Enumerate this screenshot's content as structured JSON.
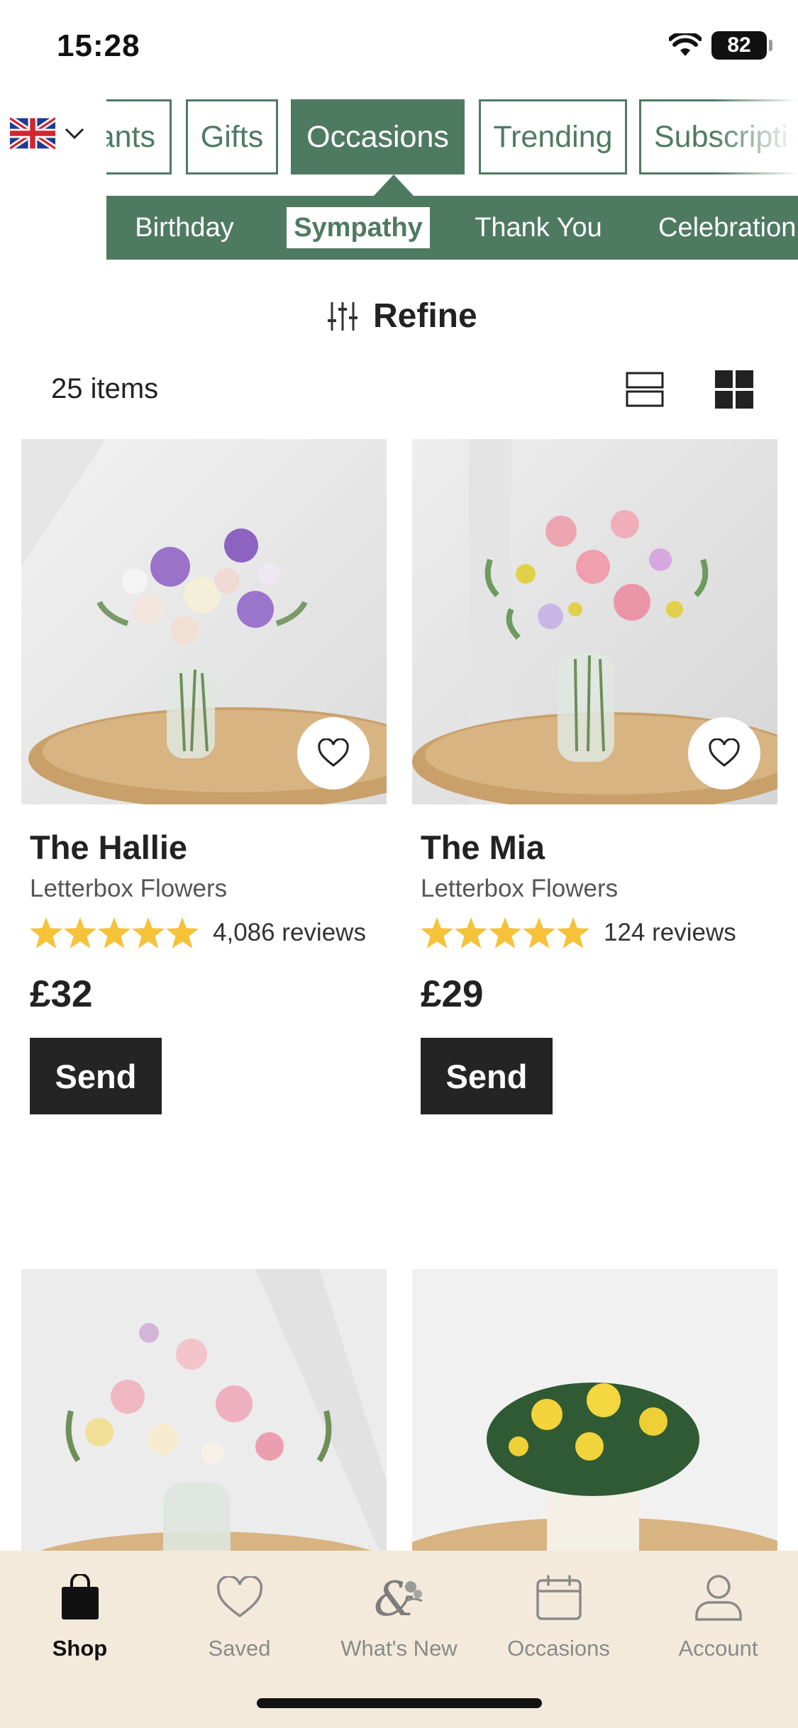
{
  "status_bar": {
    "time": "15:28",
    "battery": "82"
  },
  "colors": {
    "brand_green": "#4f7a62",
    "star_yellow": "#f5c23a",
    "tab_bar_bg": "#f4eadb",
    "button_dark": "#242424"
  },
  "nav": {
    "categories": [
      {
        "label": "ants",
        "active": false
      },
      {
        "label": "Gifts",
        "active": false
      },
      {
        "label": "Occasions",
        "active": true
      },
      {
        "label": "Trending",
        "active": false
      },
      {
        "label": "Subscripti",
        "active": false
      }
    ],
    "subcategories": [
      {
        "label": "Birthday",
        "active": false
      },
      {
        "label": "Sympathy",
        "active": true
      },
      {
        "label": "Thank You",
        "active": false
      },
      {
        "label": "Celebration",
        "active": false
      }
    ]
  },
  "toolbar": {
    "refine_label": "Refine",
    "item_count": "25 items"
  },
  "products": [
    {
      "name": "The Hallie",
      "brand": "Letterbox Flowers",
      "rating": 5,
      "reviews": "4,086 reviews",
      "price": "£32",
      "cta": "Send"
    },
    {
      "name": "The Mia",
      "brand": "Letterbox Flowers",
      "rating": 5,
      "reviews": "124 reviews",
      "price": "£29",
      "cta": "Send"
    },
    {
      "name": "",
      "brand": "",
      "rating": null,
      "reviews": "",
      "price": "",
      "cta": ""
    },
    {
      "name": "",
      "brand": "",
      "rating": null,
      "reviews": "",
      "price": "",
      "cta": ""
    }
  ],
  "tab_bar": {
    "tabs": [
      {
        "label": "Shop",
        "icon": "shopping-bag-icon",
        "active": true
      },
      {
        "label": "Saved",
        "icon": "heart-icon",
        "active": false
      },
      {
        "label": "What's New",
        "icon": "ampersand-flower-icon",
        "active": false
      },
      {
        "label": "Occasions",
        "icon": "calendar-icon",
        "active": false
      },
      {
        "label": "Account",
        "icon": "person-icon",
        "active": false
      }
    ]
  }
}
